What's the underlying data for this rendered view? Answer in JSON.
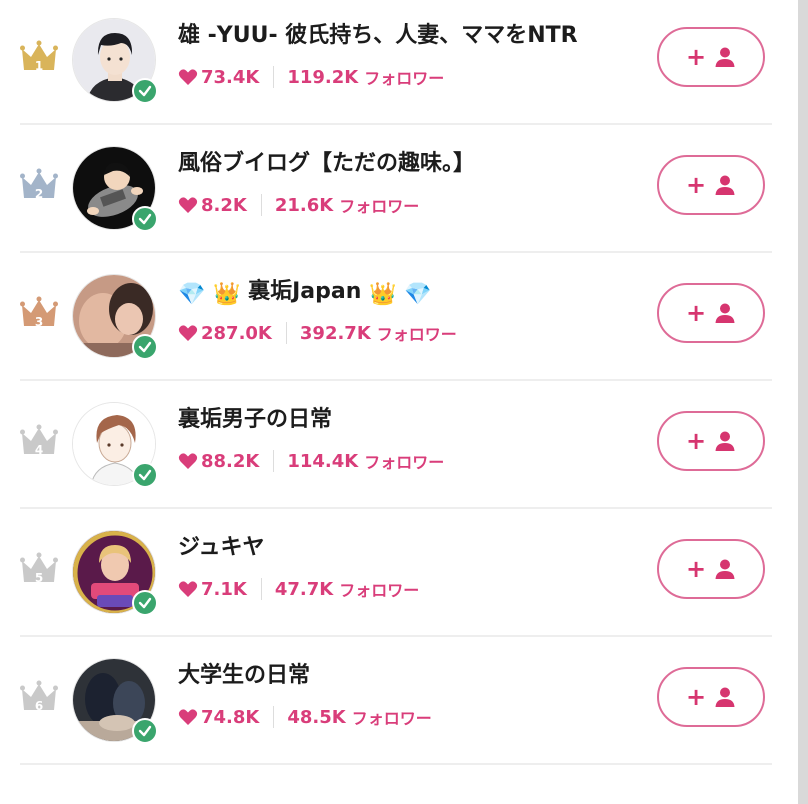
{
  "colors": {
    "accent": "#d93d7a",
    "button_border": "#de6b97",
    "verified": "#3aa56d",
    "rank_1": "#d9b45a",
    "rank_2": "#a3b4c9",
    "rank_3": "#d49a75",
    "rank_other": "#c9c9c9"
  },
  "followers_label": "フォロワー",
  "ranking": [
    {
      "rank": "1",
      "name": "雄 -YUU- 彼氏持ち、人妻、ママをNTR",
      "likes": "73.4K",
      "followers": "119.2K",
      "verified": true
    },
    {
      "rank": "2",
      "name": "風俗ブイログ【ただの趣味。】",
      "likes": "8.2K",
      "followers": "21.6K",
      "verified": true
    },
    {
      "rank": "3",
      "name_prefix": "💎 👑",
      "name": "裏垢Japan",
      "name_suffix": "👑 💎",
      "likes": "287.0K",
      "followers": "392.7K",
      "verified": true
    },
    {
      "rank": "4",
      "name": "裏垢男子の日常",
      "likes": "88.2K",
      "followers": "114.4K",
      "verified": true
    },
    {
      "rank": "5",
      "name": "ジュキヤ",
      "likes": "7.1K",
      "followers": "47.7K",
      "verified": true
    },
    {
      "rank": "6",
      "name": "大学生の日常",
      "likes": "74.8K",
      "followers": "48.5K",
      "verified": true
    }
  ],
  "icons": {
    "rank": "crown-icon",
    "likes": "heart-icon",
    "verified": "check-badge-icon",
    "follow": "add-user-icon"
  },
  "follow_button": {
    "plus": "+"
  }
}
